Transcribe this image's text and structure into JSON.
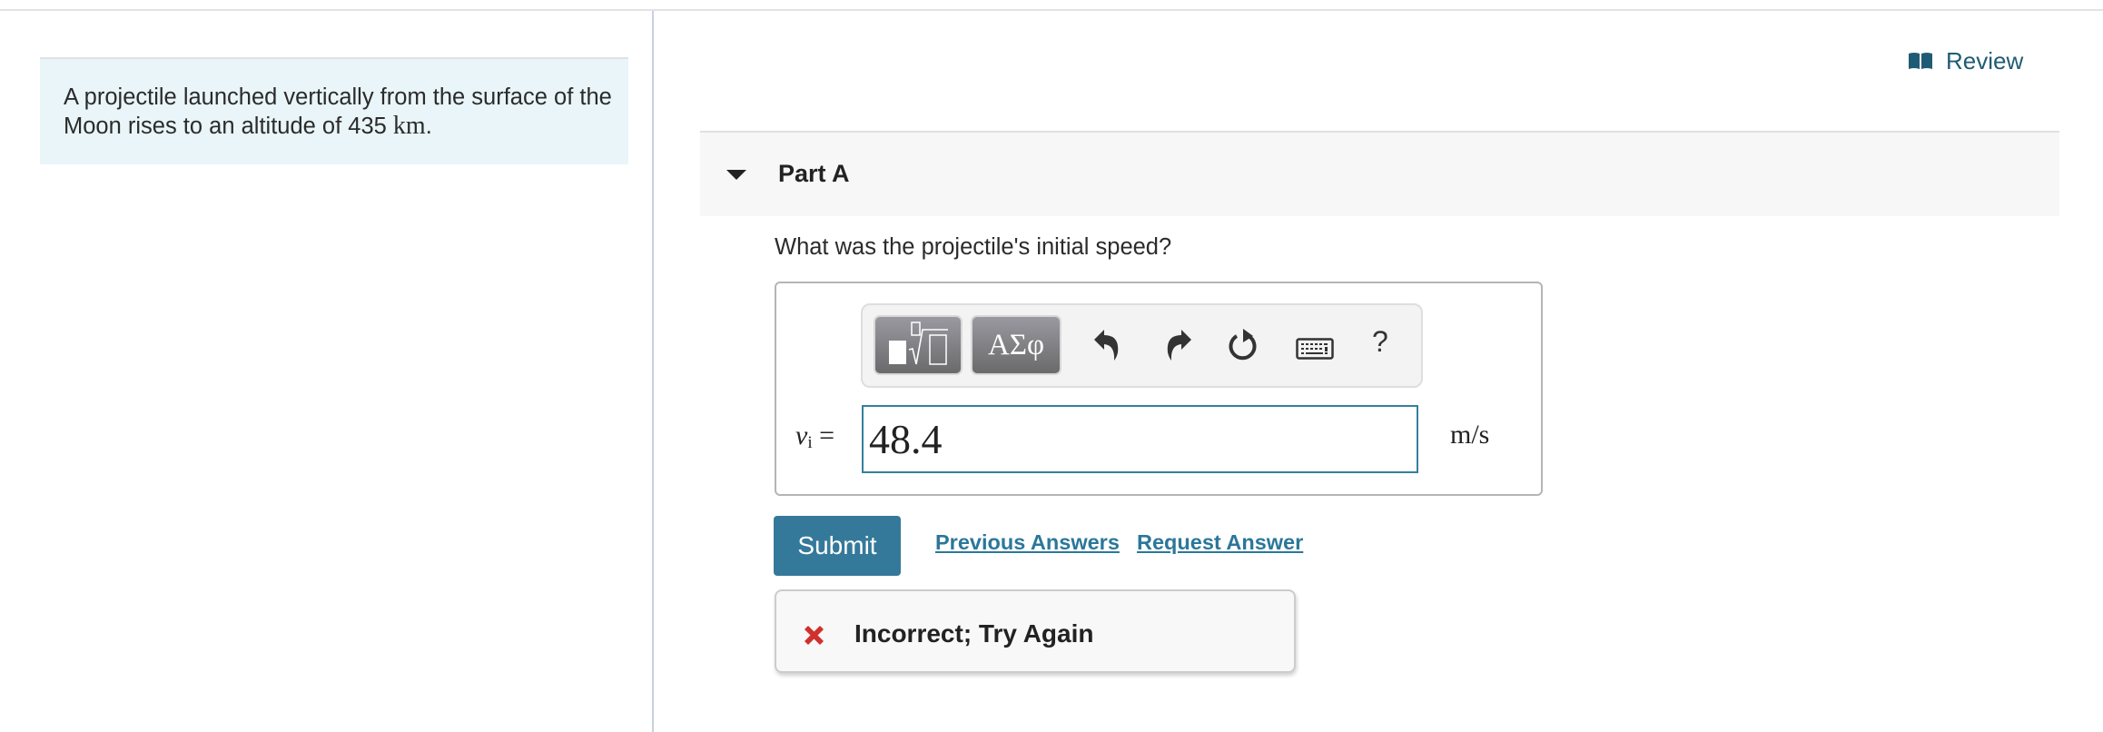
{
  "intro": {
    "text_prefix": "A projectile launched vertically from the surface of the Moon rises to an altitude of 435",
    "unit": "km",
    "text_suffix": "."
  },
  "review": {
    "label": "Review",
    "icon": "book-icon",
    "color": "#1f5c74"
  },
  "part": {
    "title": "Part A",
    "expanded": true,
    "icon": "caret-down-icon"
  },
  "question": "What was the projectile's initial speed?",
  "toolbar": {
    "templates_icon": "templates-icon",
    "symbols_label": "ΑΣφ",
    "undo_icon": "undo-icon",
    "redo_icon": "redo-icon",
    "reset_icon": "reset-icon",
    "keyboard_icon": "keyboard-icon",
    "help_label": "?"
  },
  "answer": {
    "variable": "v",
    "subscript": "i",
    "equals": "=",
    "value": "48.4",
    "unit": "m/s"
  },
  "actions": {
    "submit_label": "Submit",
    "previous_answers_label": "Previous Answers",
    "request_answer_label": "Request Answer"
  },
  "feedback": {
    "status": "incorrect",
    "icon": "x-icon",
    "text": "Incorrect; Try Again",
    "icon_color": "#d0312d"
  },
  "colors": {
    "accent": "#35799a",
    "link": "#2b779a",
    "input_border": "#34809d",
    "intro_bg": "#e9f5f8"
  }
}
